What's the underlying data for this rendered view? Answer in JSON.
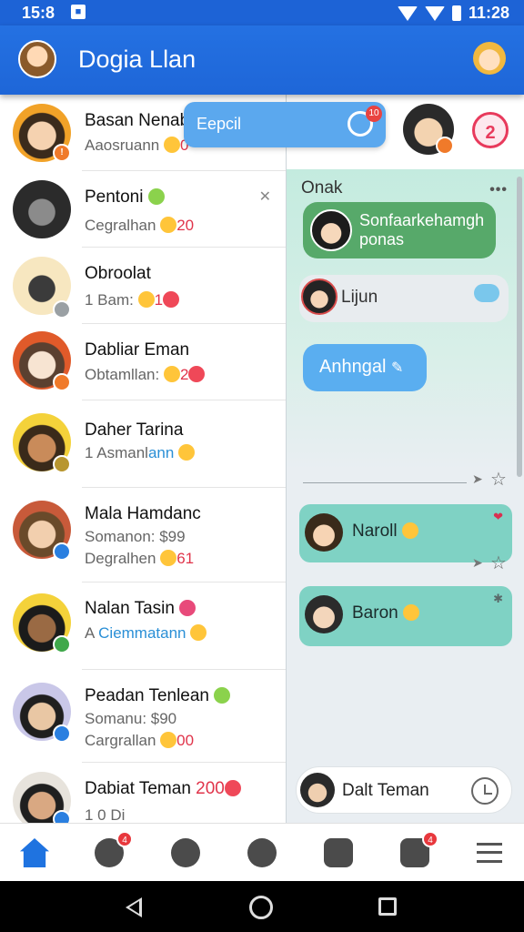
{
  "status": {
    "time": "15:8",
    "right_time": "11:28"
  },
  "app": {
    "title": "Dogia Llan"
  },
  "float_tab": {
    "label": "Eepcil",
    "badge": "10"
  },
  "chat_top": {
    "count": "2"
  },
  "contacts": [
    {
      "name": "Basan Nenab",
      "sub": "Aaosruann",
      "sub_num": "0",
      "badge_color": "#f07a2a",
      "av_color": "#f1a228"
    },
    {
      "name": "Pentoni",
      "sub": "Cegralhan",
      "sub_num": "20",
      "av_color": "#2b2b2b"
    },
    {
      "name": "Obroolat",
      "sub": "1  Bam:",
      "sub_num": "1",
      "badge_color": "#9aa0a4",
      "av_color": "#f7e7c0"
    },
    {
      "name": "Dabliar Eman",
      "sub": "Obtamllan:",
      "sub_num": "2",
      "badge_color": "#f07a2a",
      "av_color": "#e05a2a"
    },
    {
      "name": "Daher Tarina",
      "sub": "1  Asmanl",
      "sub_blue": "ann",
      "badge_color": "#b8962e",
      "av_color": "#f4d23a"
    },
    {
      "name": "Mala Hamdanc",
      "sub": "Somanon: $99",
      "sub2": "Degralhen",
      "sub2_num": "61",
      "badge_color": "#2a7fe0",
      "av_color": "#c85a3a"
    },
    {
      "name": "Nalan Tasin",
      "sub": "A",
      "sub_blue": "Ciemmatann",
      "badge_color": "#3fa84a",
      "av_color": "#f4d23a"
    },
    {
      "name": "Peadan Tenlean",
      "sub": "Somanu: $90",
      "sub2": "Cargrallan",
      "sub2_num": "00",
      "badge_color": "#2a7fe0",
      "av_color": "#c9c7e8"
    },
    {
      "name": "Dabiat Teman",
      "name_num": "200",
      "sub": "1 0 Di",
      "badge_color": "#2a7fe0",
      "av_color": "#e7e3dc"
    }
  ],
  "chat": {
    "header": "Onak",
    "green_msg": "Sonfaarkehamgh ponas",
    "white_msg": "Lijun",
    "blue_msg": "Anhngal",
    "teal1": "Naroll",
    "teal2": "Baron",
    "input_text": "Dalt Teman"
  },
  "nav": {
    "badges": [
      "4",
      "4"
    ]
  }
}
